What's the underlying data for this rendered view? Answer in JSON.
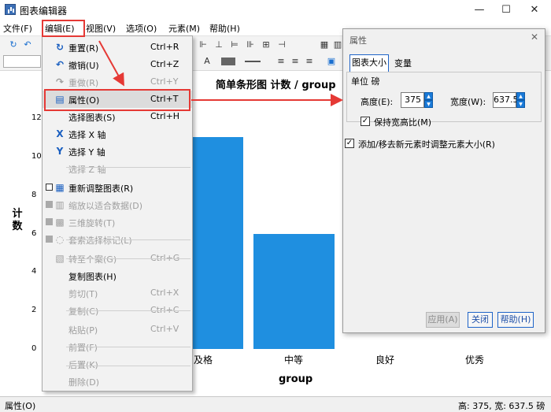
{
  "window": {
    "title": "图表编辑器",
    "minimize": "—",
    "maximize": "☐",
    "close": "✕"
  },
  "menubar": [
    {
      "label": "文件(F)"
    },
    {
      "label": "编辑(E)"
    },
    {
      "label": "视图(V)"
    },
    {
      "label": "选项(O)"
    },
    {
      "label": "元素(M)"
    },
    {
      "label": "帮助(H)"
    }
  ],
  "toolbar": {
    "text_style_label": "A",
    "color_label": "A"
  },
  "chart": {
    "title": "简单条形图 计数 / group",
    "ylabel": "计数",
    "xlabel": "group",
    "y_ticks": [
      "12",
      "10",
      "8",
      "6",
      "4",
      "2",
      "0"
    ],
    "x_ticks": [
      "及格",
      "中等",
      "良好",
      "优秀"
    ],
    "bar_color": "#1f8fe0"
  },
  "chart_data": {
    "type": "bar",
    "title": "简单条形图 计数 / group",
    "xlabel": "group",
    "ylabel": "计数",
    "categories": [
      "及格",
      "中等",
      "良好",
      "优秀"
    ],
    "values": [
      11,
      6,
      0,
      0
    ],
    "ylim": [
      0,
      12
    ],
    "grid": false
  },
  "edit_menu": [
    {
      "icon": "↻",
      "label": "重置(R)",
      "shortcut": "Ctrl+R",
      "enabled": true
    },
    {
      "icon": "↶",
      "label": "撤销(U)",
      "shortcut": "Ctrl+Z",
      "enabled": true
    },
    {
      "icon": "↷",
      "label": "重做(R)",
      "shortcut": "Ctrl+Y",
      "enabled": false
    },
    {
      "icon": "▤",
      "label": "属性(O)",
      "shortcut": "Ctrl+T",
      "enabled": true
    },
    {
      "icon": "",
      "label": "选择图表(S)",
      "shortcut": "Ctrl+H",
      "enabled": true
    },
    {
      "icon": "X",
      "label": "选择 X 轴",
      "shortcut": "",
      "enabled": true
    },
    {
      "icon": "Y",
      "label": "选择 Y 轴",
      "shortcut": "",
      "enabled": true
    },
    {
      "icon": "",
      "label": "选择 Z 轴",
      "shortcut": "",
      "enabled": false
    },
    {
      "icon": "▦",
      "label": "重新调整图表(R)",
      "shortcut": "",
      "enabled": true
    },
    {
      "icon": "▥",
      "label": "缩放以适合数据(D)",
      "shortcut": "",
      "enabled": false
    },
    {
      "icon": "▩",
      "label": "三维旋转(T)",
      "shortcut": "",
      "enabled": false
    },
    {
      "icon": "◌",
      "label": "套索选择标记(L)",
      "shortcut": "",
      "enabled": false
    },
    {
      "icon": "▧",
      "label": "转至个案(G)",
      "shortcut": "Ctrl+G",
      "enabled": false
    },
    {
      "icon": "",
      "label": "复制图表(H)",
      "shortcut": "",
      "enabled": true
    },
    {
      "icon": "",
      "label": "剪切(T)",
      "shortcut": "Ctrl+X",
      "enabled": false
    },
    {
      "icon": "",
      "label": "复制(C)",
      "shortcut": "Ctrl+C",
      "enabled": false
    },
    {
      "icon": "",
      "label": "粘贴(P)",
      "shortcut": "Ctrl+V",
      "enabled": false
    },
    {
      "icon": "",
      "label": "前置(F)",
      "shortcut": "",
      "enabled": false
    },
    {
      "icon": "",
      "label": "后置(K)",
      "shortcut": "",
      "enabled": false
    },
    {
      "icon": "",
      "label": "删除(D)",
      "shortcut": "",
      "enabled": false
    }
  ],
  "dialog": {
    "title": "属性",
    "close": "✕",
    "tabs": [
      "图表大小",
      "变量"
    ],
    "unit_label": "单位 磅",
    "height_label": "高度(E):",
    "height_value": "375",
    "width_label": "宽度(W):",
    "width_value": "637.5",
    "keep_ratio_label": "保持宽高比(M)",
    "keep_ratio_checked": true,
    "resize_label": "添加/移去新元素时调整元素大小(R)",
    "resize_checked": true,
    "apply": "应用(A)",
    "close_btn": "关闭",
    "help": "帮助(H)"
  },
  "status": {
    "left": "属性(O)",
    "right": "高: 375, 宽: 637.5 磅"
  },
  "colors": {
    "highlight": "#e53935",
    "accent": "#1e63c8"
  }
}
